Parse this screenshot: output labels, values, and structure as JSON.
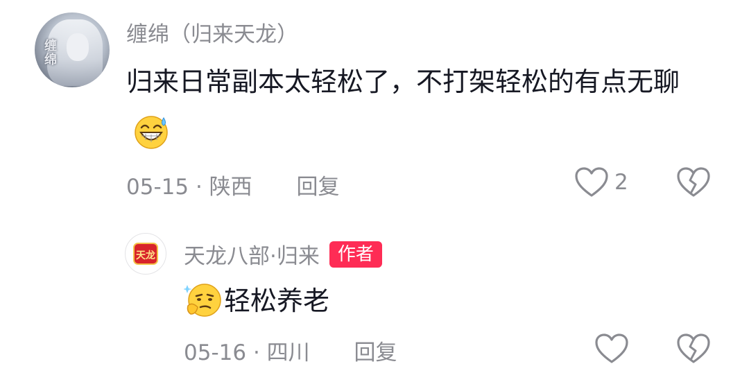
{
  "comments": [
    {
      "avatar_text": "缠绵",
      "username": "缠绵（归来天龙）",
      "text": "归来日常副本太轻松了，不打架轻松的有点无聊",
      "emoji": "grinning-sweat-emoji",
      "date": "05-15",
      "separator": " · ",
      "location": "陕西",
      "reply_label": "回复",
      "like_count": "2"
    },
    {
      "avatar_text": "天龙",
      "username": "天龙八部·归来",
      "badge": "作者",
      "emoji": "thinking-smirk-emoji",
      "text": "轻松养老",
      "date": "05-16",
      "separator": " · ",
      "location": "四川",
      "reply_label": "回复"
    }
  ],
  "colors": {
    "badge_bg": "#fe2c55",
    "meta_text": "#8a8b91",
    "body_text": "#161823"
  }
}
